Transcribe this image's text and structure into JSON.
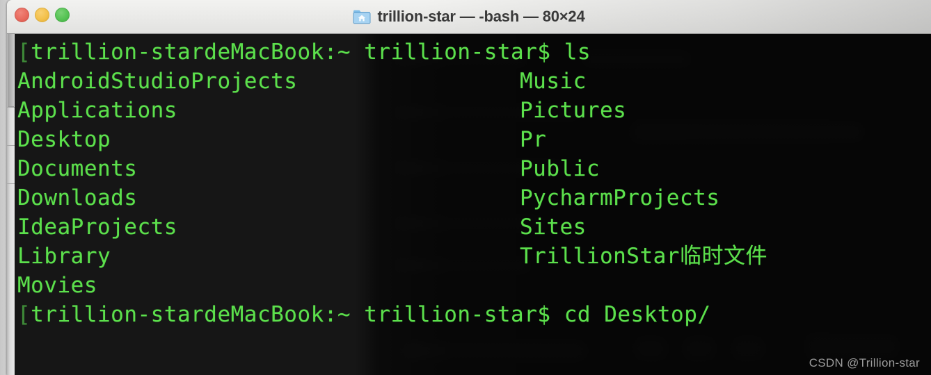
{
  "window": {
    "title": "trillion-star — -bash — 80×24",
    "icon": "home-folder-icon",
    "traffic_lights": [
      {
        "name": "close",
        "color": "#e8695c"
      },
      {
        "name": "minimize",
        "color": "#f3c04a"
      },
      {
        "name": "maximize",
        "color": "#55c253"
      }
    ]
  },
  "terminal": {
    "background": "#161616",
    "foreground": "#5ce04c",
    "prompt": "[trillion-stardeMacBook:~ trillion-star$ ",
    "lines": [
      {
        "type": "prompt",
        "prompt": "[trillion-stardeMacBook:~ trillion-star$ ",
        "command": "ls"
      },
      {
        "type": "listing",
        "col1": "AndroidStudioProjects",
        "col2": "Music"
      },
      {
        "type": "listing",
        "col1": "Applications",
        "col2": "Pictures"
      },
      {
        "type": "listing",
        "col1": "Desktop",
        "col2": "Pr"
      },
      {
        "type": "listing",
        "col1": "Documents",
        "col2": "Public"
      },
      {
        "type": "listing",
        "col1": "Downloads",
        "col2": "PycharmProjects"
      },
      {
        "type": "listing",
        "col1": "IdeaProjects",
        "col2": "Sites"
      },
      {
        "type": "listing",
        "col1": "Library",
        "col2": "TrillionStar临时文件"
      },
      {
        "type": "listing",
        "col1": "Movies",
        "col2": ""
      },
      {
        "type": "prompt",
        "prompt": "[trillion-stardeMacBook:~ trillion-star$ ",
        "command": "cd Desktop/"
      }
    ]
  },
  "watermark": {
    "text": "CSDN @Trillion-star"
  }
}
